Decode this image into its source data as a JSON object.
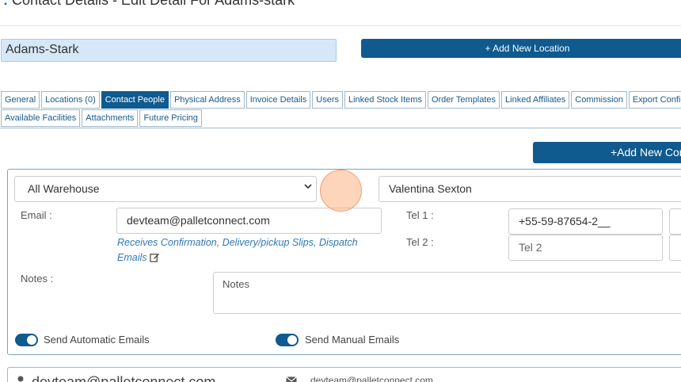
{
  "page": {
    "title": "Contact Details - Edit Detail For Adams-stark"
  },
  "company": {
    "name": "Adams-Stark"
  },
  "buttons": {
    "add_location": "+ Add New Location",
    "add_contact": "+Add New Con"
  },
  "tabs": {
    "row1": [
      "General",
      "Locations (0)",
      "Contact People",
      "Physical Address",
      "Invoice Details",
      "Users",
      "Linked Stock Items",
      "Order Templates",
      "Linked Affiliates",
      "Commission",
      "Export Configuration"
    ],
    "row2": [
      "Available Facilities",
      "Attachments",
      "Future Pricing"
    ],
    "active": "Contact People"
  },
  "contact": {
    "warehouse_select": "All Warehouse",
    "name": "Valentina Sexton",
    "email_label": "Email :",
    "email": "devteam@palletconnect.com",
    "email_note": "Receives Confirmation, Delivery/pickup Slips, Dispatch Emails",
    "tel1_label": "Tel 1 :",
    "tel1": "+55-59-87654-2__",
    "tel2_label": "Tel 2 :",
    "tel2_placeholder": "Tel 2",
    "notes_label": "Notes :",
    "notes_placeholder": "Notes",
    "send_auto_label": "Send Automatic Emails",
    "send_auto_on": true,
    "send_manual_label": "Send Manual Emails",
    "send_manual_on": true
  },
  "next_contact": {
    "email": "devteam@palletconnect.com",
    "email_secondary": "devteam@palletconnect.com"
  },
  "icons": [
    "chevron-down-icon",
    "edit-icon",
    "person-icon",
    "mail-icon"
  ],
  "colors": {
    "primary": "#0f5a8f",
    "name_field_bg": "#d6e8f7",
    "link": "#2f78b8"
  }
}
